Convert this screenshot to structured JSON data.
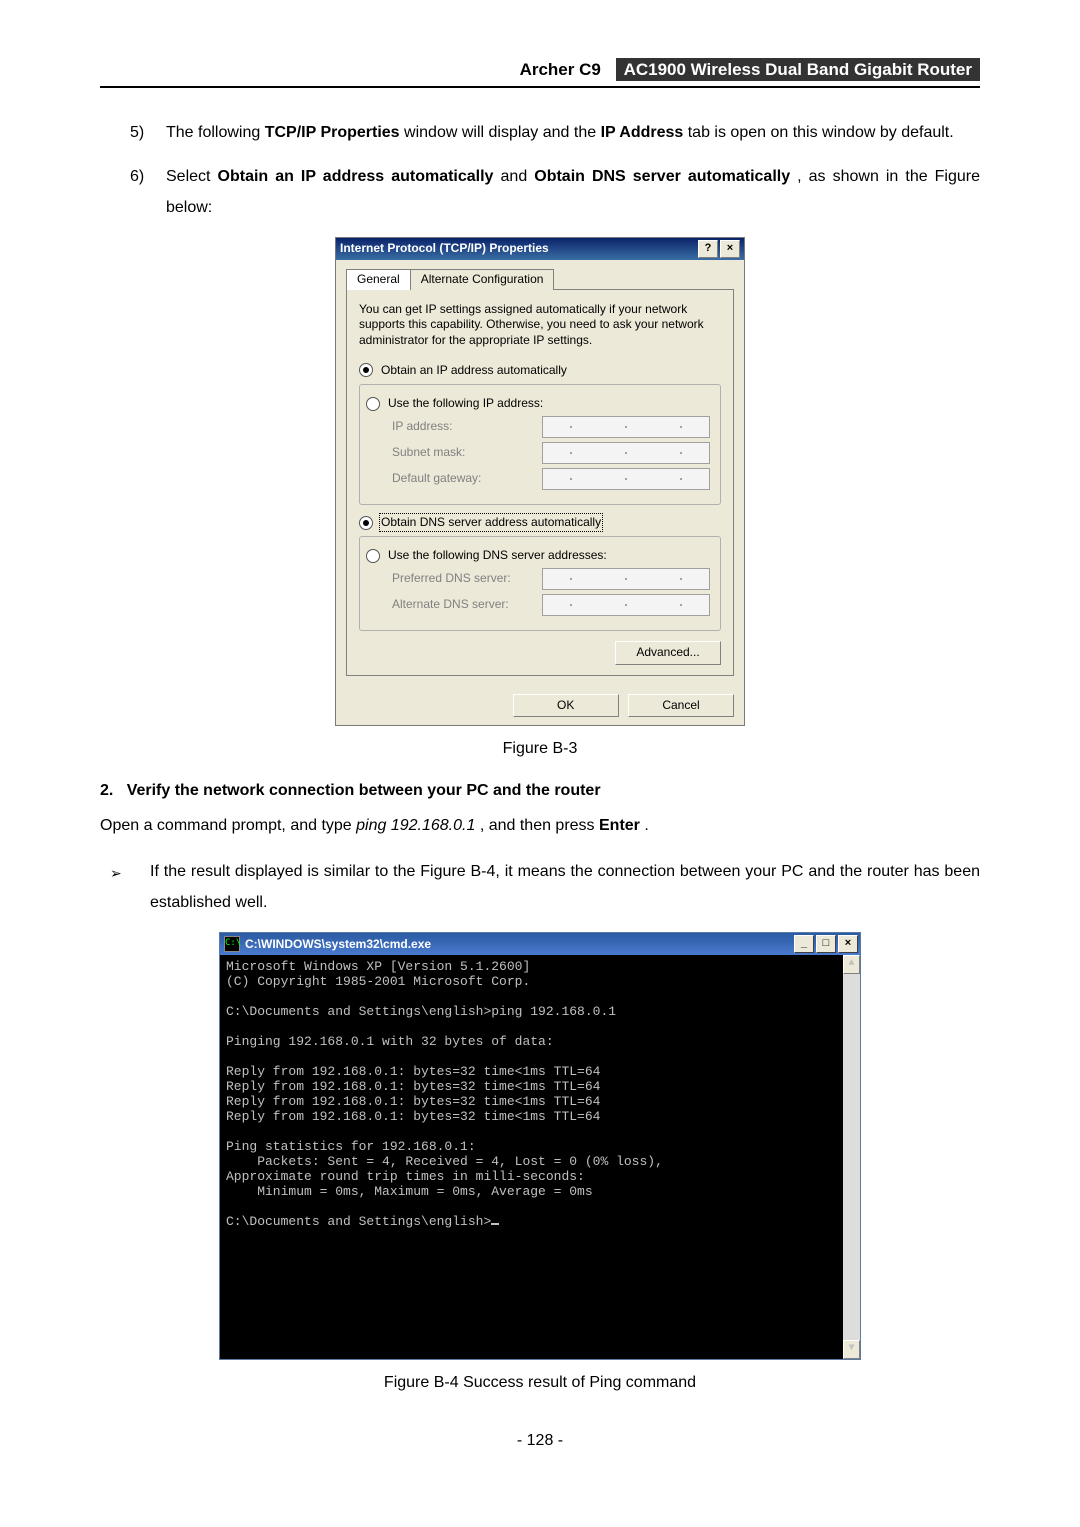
{
  "header": {
    "model": "Archer C9",
    "product": "AC1900 Wireless Dual Band Gigabit Router"
  },
  "steps": {
    "s5": {
      "num": "5)",
      "pre": "The following ",
      "b1": "TCP/IP Properties",
      "mid": " window will display and the ",
      "b2": "IP Address",
      "post": " tab is open on this window by default."
    },
    "s6": {
      "num": "6)",
      "pre": "Select ",
      "b1": "Obtain an IP address automatically",
      "mid": " and ",
      "b2": "Obtain DNS server automatically",
      "post": ", as shown in the Figure below:"
    }
  },
  "tcpip": {
    "title": "Internet Protocol (TCP/IP) Properties",
    "help_btn": "?",
    "close_btn": "×",
    "tabs": {
      "general": "General",
      "alt": "Alternate Configuration"
    },
    "intro": "You can get IP settings assigned automatically if your network supports this capability. Otherwise, you need to ask your network administrator for the appropriate IP settings.",
    "r_auto_ip": "Obtain an IP address automatically",
    "r_manual_ip": "Use the following IP address:",
    "lbl_ip": "IP address:",
    "lbl_subnet": "Subnet mask:",
    "lbl_gateway": "Default gateway:",
    "r_auto_dns": "Obtain DNS server address automatically",
    "r_manual_dns": "Use the following DNS server addresses:",
    "lbl_pref_dns": "Preferred DNS server:",
    "lbl_alt_dns": "Alternate DNS server:",
    "advanced": "Advanced...",
    "ok": "OK",
    "cancel": "Cancel"
  },
  "caption1": "Figure B-3",
  "section2": {
    "num": "2.",
    "title": "Verify the network connection between your PC and the router",
    "open": {
      "pre": "Open a command prompt, and type ",
      "cmd": "ping 192.168.0.1",
      "mid": ", and then press ",
      "enter": "Enter",
      "post": "."
    },
    "bullet": {
      "glyph": "➢",
      "text": "If the result displayed is similar to the Figure B-4, it means the connection between your PC and the router has been established well."
    }
  },
  "cmd": {
    "icon": "C:\\",
    "title": "C:\\WINDOWS\\system32\\cmd.exe",
    "min": "_",
    "max": "□",
    "close": "×",
    "lines": [
      "Microsoft Windows XP [Version 5.1.2600]",
      "(C) Copyright 1985-2001 Microsoft Corp.",
      "",
      "C:\\Documents and Settings\\english>ping 192.168.0.1",
      "",
      "Pinging 192.168.0.1 with 32 bytes of data:",
      "",
      "Reply from 192.168.0.1: bytes=32 time<1ms TTL=64",
      "Reply from 192.168.0.1: bytes=32 time<1ms TTL=64",
      "Reply from 192.168.0.1: bytes=32 time<1ms TTL=64",
      "Reply from 192.168.0.1: bytes=32 time<1ms TTL=64",
      "",
      "Ping statistics for 192.168.0.1:",
      "    Packets: Sent = 4, Received = 4, Lost = 0 (0% loss),",
      "Approximate round trip times in milli-seconds:",
      "    Minimum = 0ms, Maximum = 0ms, Average = 0ms",
      "",
      "C:\\Documents and Settings\\english>"
    ],
    "scroll_up": "▲",
    "scroll_dn": "▼"
  },
  "caption2": "Figure B-4 Success result of Ping command",
  "page_number": "- 128 -"
}
